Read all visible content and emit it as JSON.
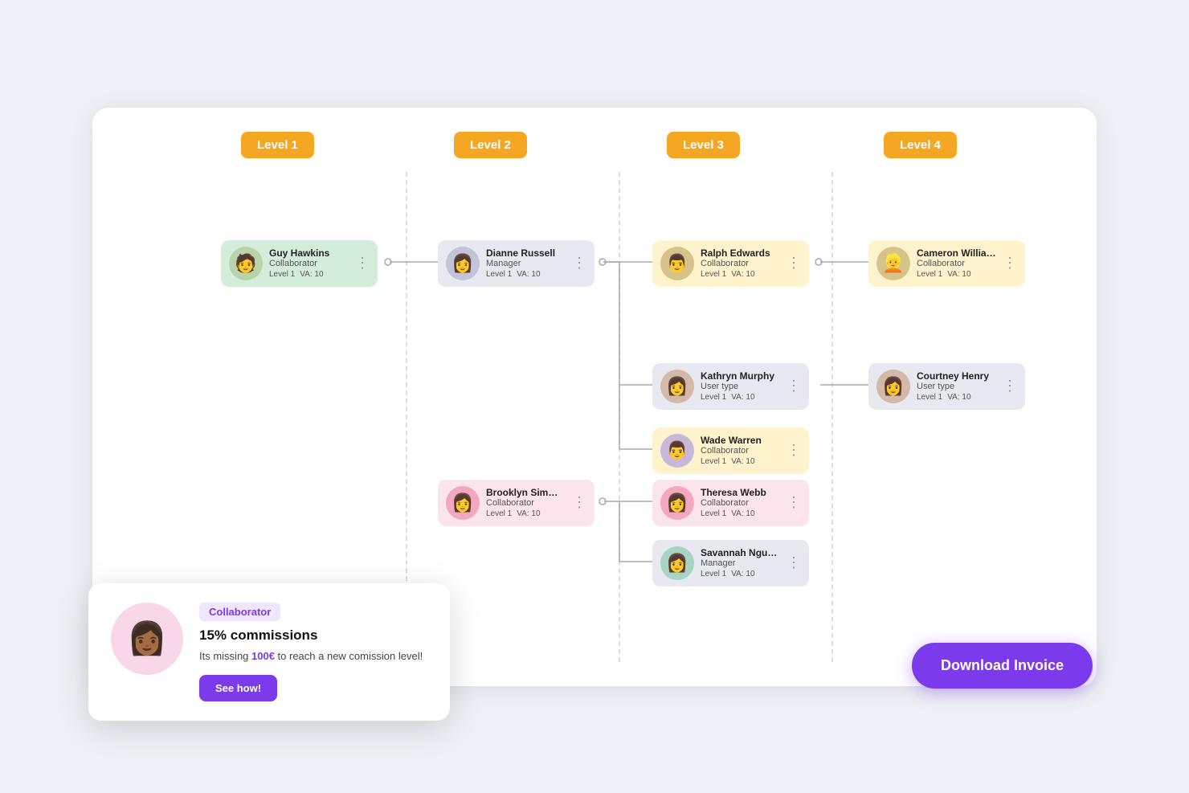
{
  "levels": [
    {
      "id": "level1",
      "label": "Level 1"
    },
    {
      "id": "level2",
      "label": "Level 2"
    },
    {
      "id": "level3",
      "label": "Level 3"
    },
    {
      "id": "level4",
      "label": "Level 4"
    }
  ],
  "nodes": {
    "guy": {
      "name": "Guy Hawkins",
      "role": "Collaborator",
      "level": "Level 1",
      "va": "VA: 10",
      "emoji": "🧑"
    },
    "dianne": {
      "name": "Dianne Russell",
      "role": "Manager",
      "level": "Level 1",
      "va": "VA: 10",
      "emoji": "👩"
    },
    "ralph": {
      "name": "Ralph Edwards",
      "role": "Collaborator",
      "level": "Level 1",
      "va": "VA: 10",
      "emoji": "👨"
    },
    "cameron": {
      "name": "Cameron Williamson",
      "role": "Collaborator",
      "level": "Level 1",
      "va": "VA: 10",
      "emoji": "👱"
    },
    "kathryn": {
      "name": "Kathryn Murphy",
      "role": "User type",
      "level": "Level 1",
      "va": "VA: 10",
      "emoji": "👩"
    },
    "courtney": {
      "name": "Courtney Henry",
      "role": "User type",
      "level": "Level 1",
      "va": "VA: 10",
      "emoji": "👩"
    },
    "wade": {
      "name": "Wade Warren",
      "role": "Collaborator",
      "level": "Level 1",
      "va": "VA: 10",
      "emoji": "👨"
    },
    "brooklyn": {
      "name": "Brooklyn Simmons",
      "role": "Collaborator",
      "level": "Level 1",
      "va": "VA: 10",
      "emoji": "👩"
    },
    "theresa": {
      "name": "Theresa Webb",
      "role": "Collaborator",
      "level": "Level 1",
      "va": "VA: 10",
      "emoji": "👩"
    },
    "savannah": {
      "name": "Savannah Nguyen",
      "role": "Manager",
      "level": "Level 1",
      "va": "VA: 10",
      "emoji": "👩"
    }
  },
  "popup": {
    "badge": "Collaborator",
    "title": "15% commissions",
    "desc_prefix": "Its missing ",
    "amount": "100€",
    "desc_suffix": " to reach a new comission level!",
    "button_label": "See how!"
  },
  "download_btn": "Download Invoice"
}
